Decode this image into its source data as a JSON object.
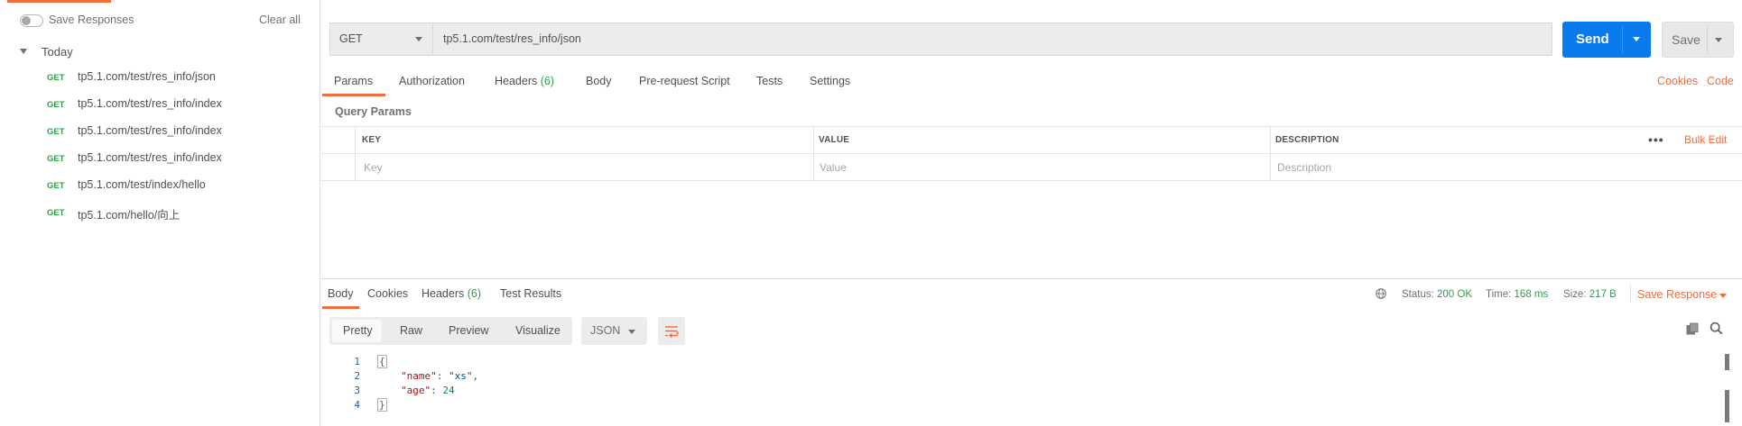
{
  "sidebar": {
    "save_responses_label": "Save Responses",
    "clear_all_label": "Clear all",
    "group_label": "Today",
    "history": [
      {
        "method": "GET",
        "url": "tp5.1.com/test/res_info/json"
      },
      {
        "method": "GET",
        "url": "tp5.1.com/test/res_info/index"
      },
      {
        "method": "GET",
        "url": "tp5.1.com/test/res_info/index"
      },
      {
        "method": "GET",
        "url": "tp5.1.com/test/res_info/index"
      },
      {
        "method": "GET",
        "url": "tp5.1.com/test/index/hello"
      },
      {
        "method": "GET",
        "url": "tp5.1.com/hello/向上"
      }
    ]
  },
  "request": {
    "method": "GET",
    "url": "tp5.1.com/test/res_info/json",
    "send_label": "Send",
    "save_label": "Save",
    "tabs": {
      "params": "Params",
      "authorization": "Authorization",
      "headers": "Headers",
      "headers_count": "(6)",
      "body": "Body",
      "prerequest": "Pre-request Script",
      "tests": "Tests",
      "settings": "Settings"
    },
    "cookies_link": "Cookies",
    "code_link": "Code",
    "query_params_label": "Query Params",
    "table": {
      "col_key": "KEY",
      "col_value": "VALUE",
      "col_description": "DESCRIPTION",
      "ph_key": "Key",
      "ph_value": "Value",
      "ph_description": "Description",
      "bulk_edit": "Bulk Edit",
      "more_icon": "more-dots-icon"
    }
  },
  "response": {
    "tabs": {
      "body": "Body",
      "cookies": "Cookies",
      "headers": "Headers",
      "headers_count": "(6)",
      "test_results": "Test Results"
    },
    "status_label": "Status:",
    "status_value": "200 OK",
    "time_label": "Time:",
    "time_value": "168 ms",
    "size_label": "Size:",
    "size_value": "217 B",
    "save_response_label": "Save Response",
    "view_modes": {
      "pretty": "Pretty",
      "raw": "Raw",
      "preview": "Preview",
      "visualize": "Visualize"
    },
    "format": "JSON",
    "line_numbers": [
      "1",
      "2",
      "3",
      "4"
    ],
    "code": {
      "open": "{",
      "key_name": "\"name\"",
      "val_name": "\"xs\"",
      "key_age": "\"age\"",
      "val_age": "24",
      "close": "}"
    }
  },
  "colors": {
    "accent": "#f26b3a",
    "send_blue": "#097bed",
    "get_green": "#2f9f49"
  }
}
